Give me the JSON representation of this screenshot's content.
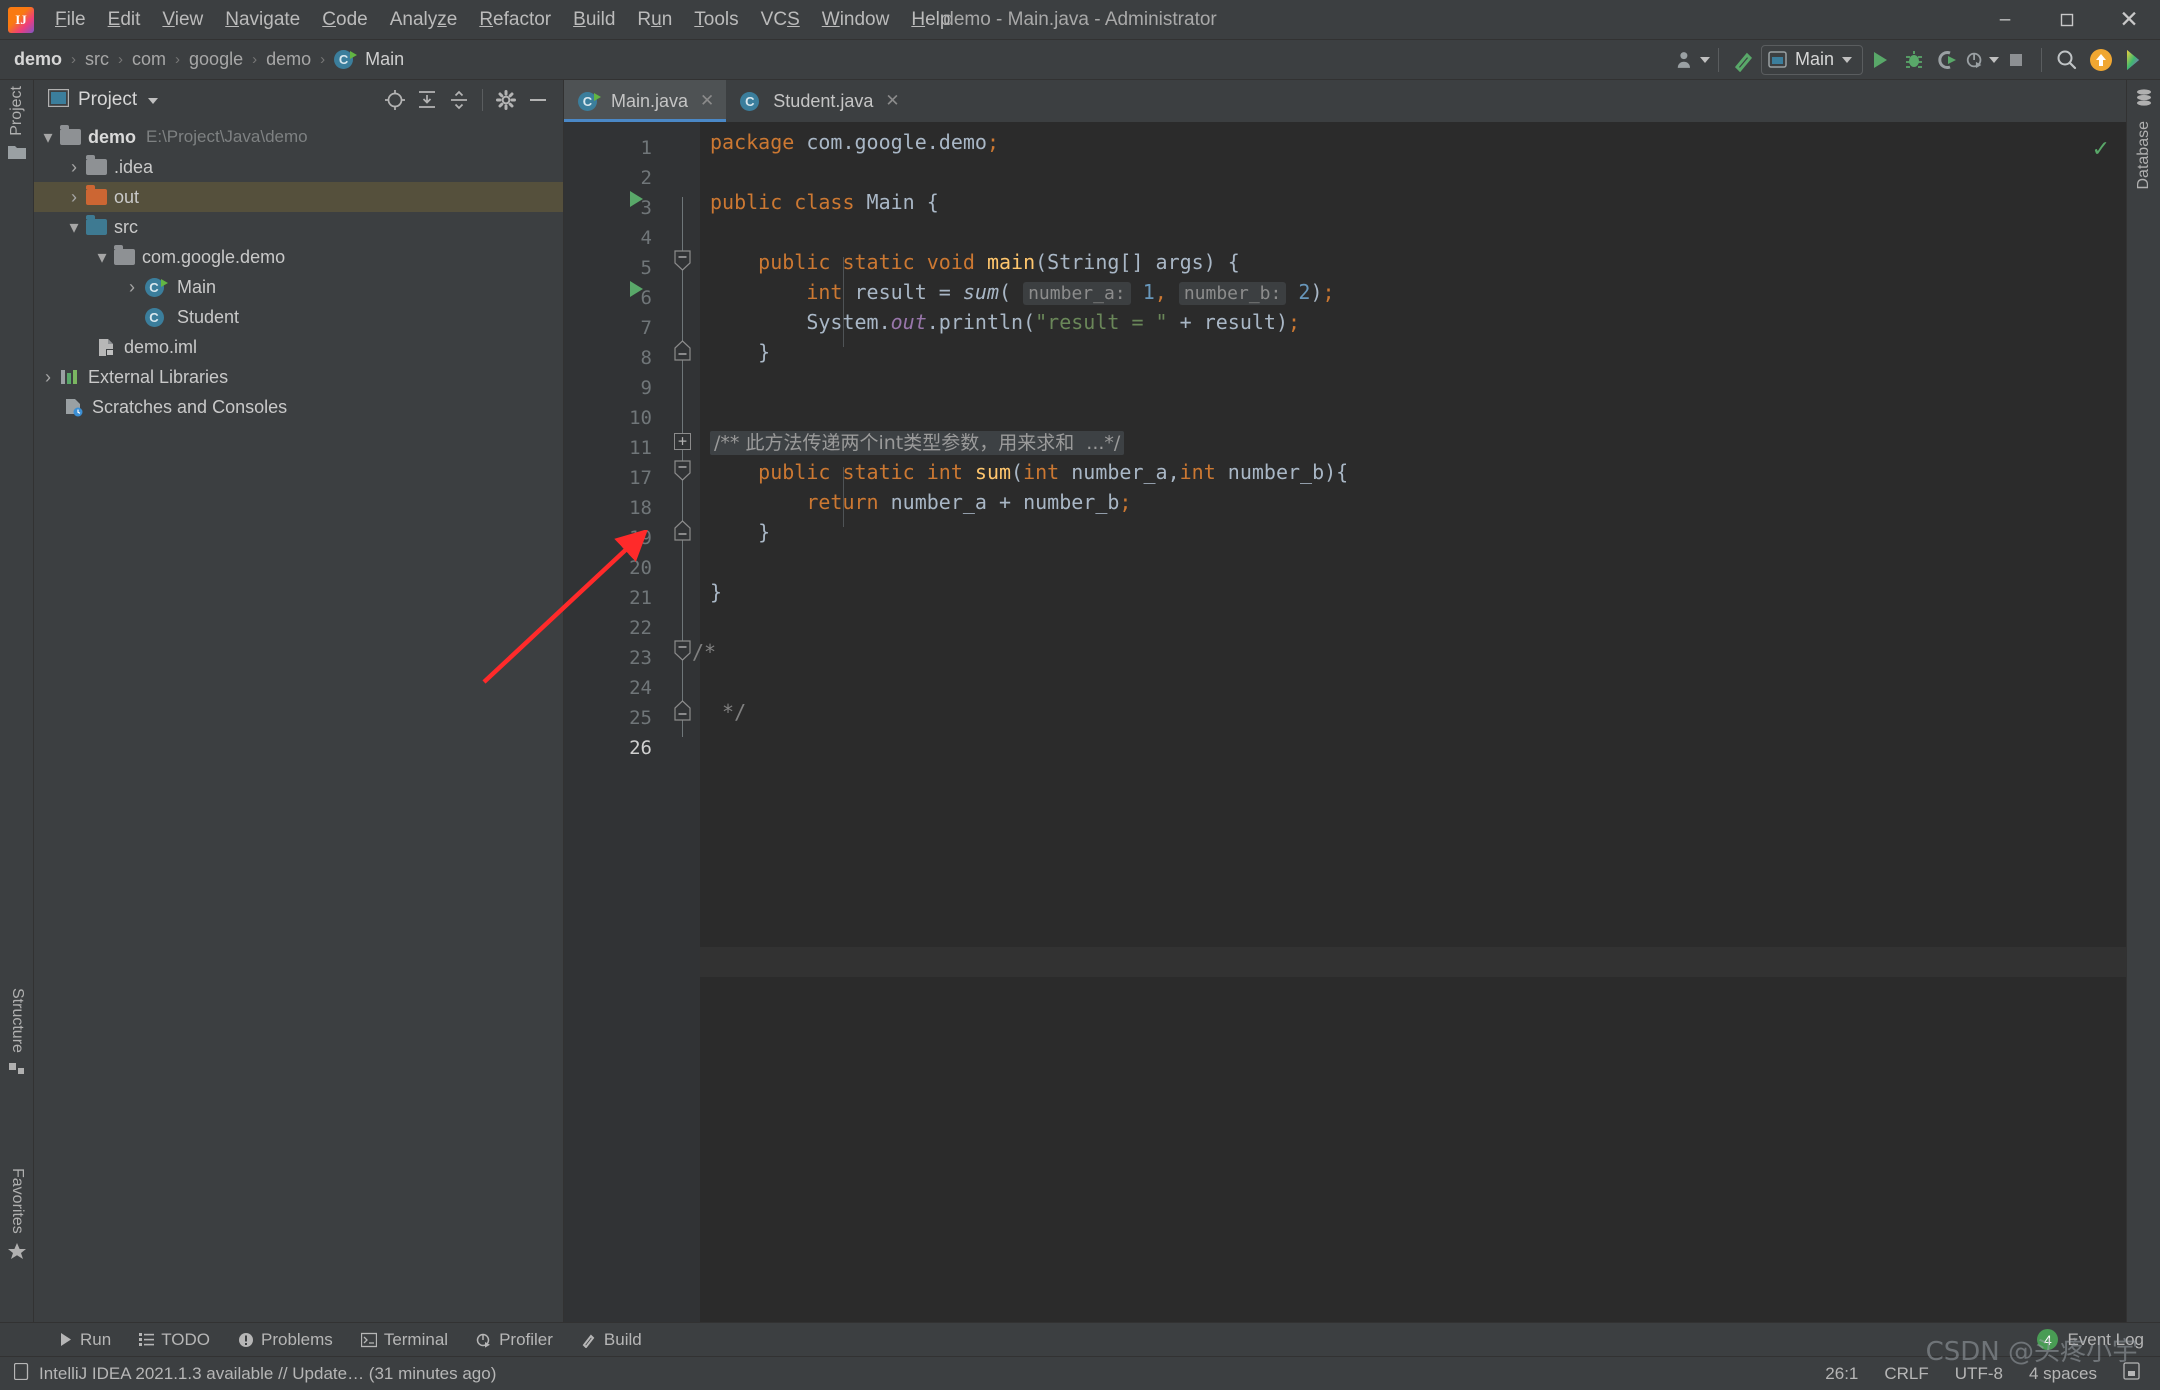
{
  "window": {
    "title": "demo - Main.java - Administrator",
    "app_icon": "intellij-idea-icon",
    "minimize": "–",
    "maximize": "❐",
    "close": "✕"
  },
  "menubar": {
    "items": [
      "File",
      "Edit",
      "View",
      "Navigate",
      "Code",
      "Analyze",
      "Refactor",
      "Build",
      "Run",
      "Tools",
      "VCS",
      "Window",
      "Help"
    ]
  },
  "breadcrumb": {
    "items": [
      "demo",
      "src",
      "com",
      "google",
      "demo",
      "Main"
    ],
    "separator": "›"
  },
  "toolbar": {
    "run_config": "Main",
    "icons": [
      "user-icon",
      "build-hammer-icon",
      "run-icon",
      "debug-icon",
      "run-coverage-icon",
      "profiler-icon",
      "stop-icon",
      "search-icon",
      "update-icon",
      "idea-pro-icon"
    ]
  },
  "left_strip": {
    "top_tab": "Project",
    "bottom_tabs": [
      "Structure",
      "Favorites"
    ]
  },
  "right_strip": {
    "tabs": [
      "Database"
    ]
  },
  "project_panel": {
    "title": "Project",
    "actions": [
      "locate-icon",
      "expand-all-icon",
      "collapse-all-icon",
      "settings-gear-icon",
      "hide-icon"
    ],
    "tree": [
      {
        "label": "demo",
        "sublabel": "E:\\Project\\Java\\demo",
        "icon": "module-folder-icon",
        "arrow": "⌄",
        "indent": 0,
        "bold": true,
        "selected": false
      },
      {
        "label": ".idea",
        "sublabel": "",
        "icon": "folder-icon",
        "arrow": "›",
        "indent": 1,
        "bold": false,
        "selected": false
      },
      {
        "label": "out",
        "sublabel": "",
        "icon": "folder-orange-icon",
        "arrow": "›",
        "indent": 1,
        "bold": false,
        "selected": true
      },
      {
        "label": "src",
        "sublabel": "",
        "icon": "source-folder-icon",
        "arrow": "⌄",
        "indent": 1,
        "bold": false,
        "selected": false
      },
      {
        "label": "com.google.demo",
        "sublabel": "",
        "icon": "package-icon",
        "arrow": "⌄",
        "indent": 2,
        "bold": false,
        "selected": false
      },
      {
        "label": "Main",
        "sublabel": "",
        "icon": "java-class-runnable-icon",
        "arrow": "›",
        "indent": 3,
        "bold": false,
        "selected": false
      },
      {
        "label": "Student",
        "sublabel": "",
        "icon": "java-class-icon",
        "arrow": "",
        "indent": 3,
        "bold": false,
        "selected": false
      },
      {
        "label": "demo.iml",
        "sublabel": "",
        "icon": "iml-file-icon",
        "arrow": "",
        "indent": 2,
        "bold": false,
        "selected": false
      },
      {
        "label": "External Libraries",
        "sublabel": "",
        "icon": "libraries-icon",
        "arrow": "›",
        "indent": 0,
        "bold": false,
        "selected": false
      },
      {
        "label": "Scratches and Consoles",
        "sublabel": "",
        "icon": "scratches-icon",
        "arrow": "",
        "indent": 0,
        "bold": false,
        "selected": false
      }
    ]
  },
  "editor": {
    "tabs": [
      {
        "label": "Main.java",
        "icon": "java-class-runnable-icon",
        "active": true,
        "close": "✕"
      },
      {
        "label": "Student.java",
        "icon": "java-class-icon",
        "active": false,
        "close": "✕"
      }
    ],
    "inspection_status": "✓",
    "line_numbers": [
      "1",
      "2",
      "3",
      "4",
      "5",
      "6",
      "7",
      "8",
      "9",
      "10",
      "11",
      "17",
      "18",
      "19",
      "20",
      "21",
      "22",
      "23",
      "24",
      "25",
      "26"
    ],
    "current_line_index": 20,
    "code_lines": [
      {
        "n": "1",
        "text": "package com.google.demo;"
      },
      {
        "n": "2",
        "text": ""
      },
      {
        "n": "3",
        "text": "public class Main {"
      },
      {
        "n": "4",
        "text": ""
      },
      {
        "n": "5",
        "text": "    public static void main(String[] args) {"
      },
      {
        "n": "6",
        "text": "        int result = sum( number_a: 1, number_b: 2);"
      },
      {
        "n": "7",
        "text": "        System.out.println(\"result = \" + result);"
      },
      {
        "n": "8",
        "text": "    }"
      },
      {
        "n": "9",
        "text": ""
      },
      {
        "n": "10",
        "text": ""
      },
      {
        "n": "11",
        "text": "/** 此方法传递两个int类型参数，用来求和 ...*/"
      },
      {
        "n": "17",
        "text": "    public static int sum(int number_a,int number_b){"
      },
      {
        "n": "18",
        "text": "        return number_a + number_b;"
      },
      {
        "n": "19",
        "text": "    }"
      },
      {
        "n": "20",
        "text": ""
      },
      {
        "n": "21",
        "text": "}"
      },
      {
        "n": "22",
        "text": ""
      },
      {
        "n": "23",
        "text": "/*"
      },
      {
        "n": "24",
        "text": ""
      },
      {
        "n": "25",
        "text": " */"
      },
      {
        "n": "26",
        "text": ""
      }
    ],
    "folded_comment": "/** 此方法传递两个int类型参数，用来求和  ...*/",
    "param_hints": [
      "number_a:",
      "number_b:"
    ]
  },
  "tool_windows": {
    "items": [
      {
        "label": "Run",
        "icon": "run-icon"
      },
      {
        "label": "TODO",
        "icon": "todo-icon"
      },
      {
        "label": "Problems",
        "icon": "problems-icon"
      },
      {
        "label": "Terminal",
        "icon": "terminal-icon"
      },
      {
        "label": "Profiler",
        "icon": "profiler-icon"
      },
      {
        "label": "Build",
        "icon": "build-hammer-icon"
      }
    ],
    "event_log": {
      "label": "Event Log",
      "count": "4"
    }
  },
  "status_bar": {
    "message": "IntelliJ IDEA 2021.1.3 available // Update… (31 minutes ago)",
    "message_icon": "ide-update-icon",
    "caret": "26:1",
    "line_separator": "CRLF",
    "encoding": "UTF-8",
    "indent": "4 spaces",
    "lock_icon": "lock-icon"
  },
  "watermark": {
    "text": "CSDN @头疼小宇"
  },
  "colors": {
    "accent": "#4a88c7",
    "selected_row": "#55503c",
    "run_green": "#59a869",
    "keyword_orange": "#cc7832",
    "string_green": "#6a8759",
    "number_blue": "#6897bb",
    "method_yellow": "#ffc66d",
    "annotation_arrow": "#ff2a2a"
  }
}
